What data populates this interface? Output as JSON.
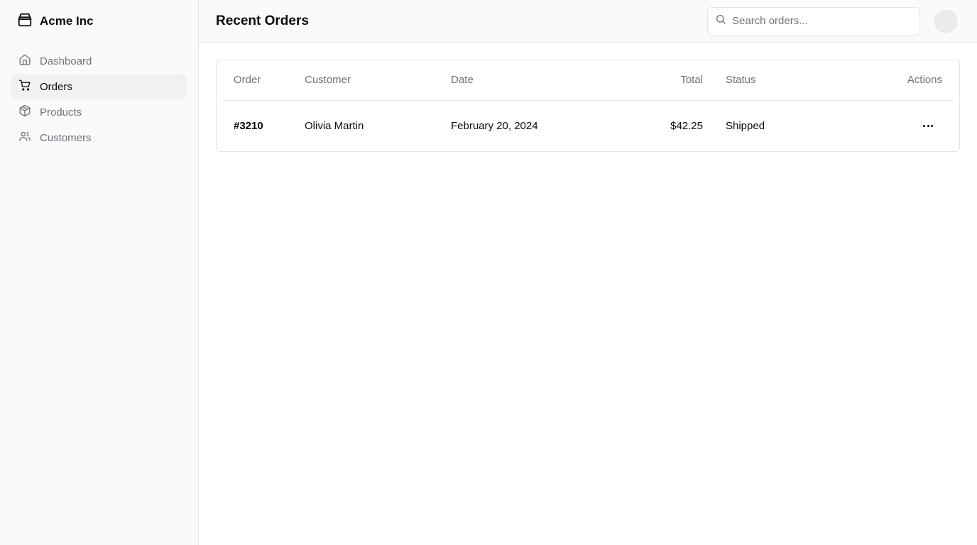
{
  "brand": {
    "name": "Acme Inc",
    "icon": "store-icon"
  },
  "sidebar": {
    "items": [
      {
        "label": "Dashboard",
        "icon": "home-icon",
        "active": false
      },
      {
        "label": "Orders",
        "icon": "cart-icon",
        "active": true
      },
      {
        "label": "Products",
        "icon": "package-icon",
        "active": false
      },
      {
        "label": "Customers",
        "icon": "users-icon",
        "active": false
      }
    ]
  },
  "header": {
    "title": "Recent Orders",
    "search": {
      "placeholder": "Search orders...",
      "value": ""
    }
  },
  "orders": {
    "columns": [
      "Order",
      "Customer",
      "Date",
      "Total",
      "Status",
      "Actions"
    ],
    "rows": [
      {
        "order": "#3210",
        "customer": "Olivia Martin",
        "date": "February 20, 2024",
        "total": "$42.25",
        "status": "Shipped"
      }
    ]
  },
  "colors": {
    "sidebar_bg": "#f9fafa",
    "active_item_bg": "#f0f1f3",
    "border": "#e4e4e7",
    "muted_text": "#71717a",
    "text": "#0a0a0a"
  }
}
